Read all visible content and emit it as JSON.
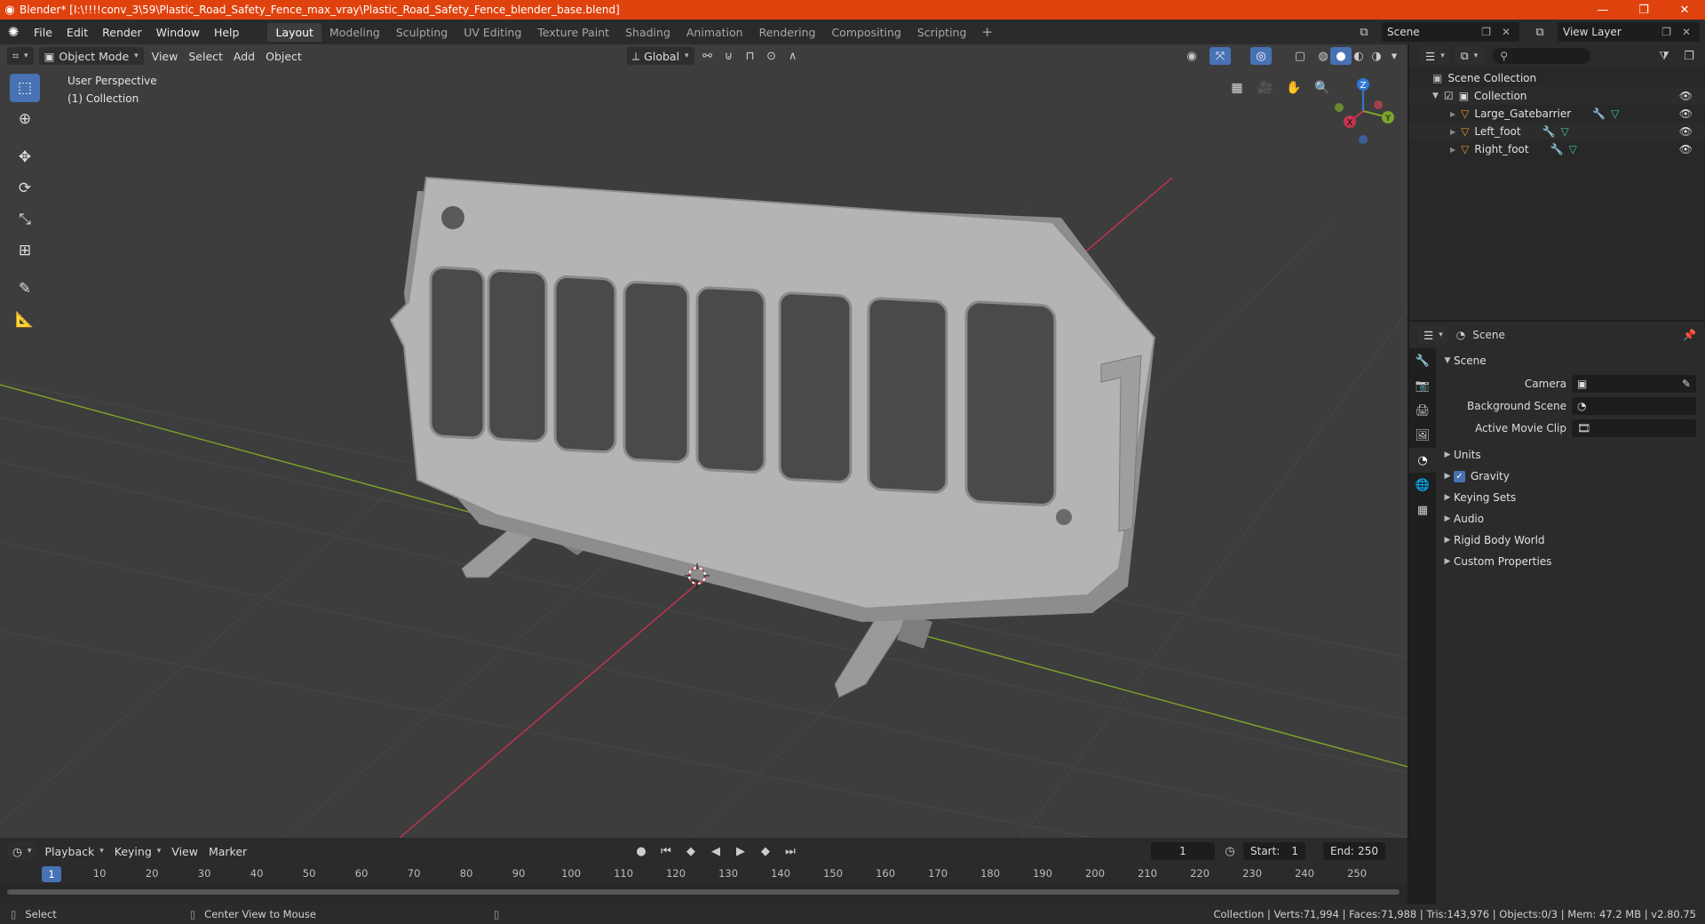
{
  "window": {
    "title": "Blender* [I:\\!!!!conv_3\\59\\Plastic_Road_Safety_Fence_max_vray\\Plastic_Road_Safety_Fence_blender_base.blend]"
  },
  "menu": [
    "File",
    "Edit",
    "Render",
    "Window",
    "Help"
  ],
  "workspaces": [
    "Layout",
    "Modeling",
    "Sculpting",
    "UV Editing",
    "Texture Paint",
    "Shading",
    "Animation",
    "Rendering",
    "Compositing",
    "Scripting"
  ],
  "scene_name": "Scene",
  "view_layer": "View Layer",
  "viewport": {
    "mode": "Object Mode",
    "menus": [
      "View",
      "Select",
      "Add",
      "Object"
    ],
    "transform": "Global",
    "perspective": "User Perspective",
    "collection": "(1) Collection",
    "gizmo": {
      "x": "X",
      "y": "Y",
      "z": "Z"
    }
  },
  "outliner": {
    "root": "Scene Collection",
    "collection": "Collection",
    "objects": [
      "Large_Gatebarrier",
      "Left_foot",
      "Right_foot"
    ]
  },
  "properties": {
    "context": "Scene",
    "panel": "Scene",
    "camera_label": "Camera",
    "background_label": "Background Scene",
    "movieclip_label": "Active Movie Clip",
    "subpanels": [
      "Units",
      "Gravity",
      "Keying Sets",
      "Audio",
      "Rigid Body World",
      "Custom Properties"
    ]
  },
  "timeline": {
    "menus": [
      "Playback",
      "Keying",
      "View",
      "Marker"
    ],
    "current_frame": "1",
    "start_label": "Start:",
    "start": "1",
    "end_label": "End:",
    "end": "250",
    "ticks": [
      "1",
      "10",
      "20",
      "30",
      "40",
      "50",
      "60",
      "70",
      "80",
      "90",
      "100",
      "110",
      "120",
      "130",
      "140",
      "150",
      "160",
      "170",
      "180",
      "190",
      "200",
      "210",
      "220",
      "230",
      "240",
      "250"
    ]
  },
  "status": {
    "left": "Select",
    "middle": "Center View to Mouse",
    "stats": "Collection | Verts:71,994 | Faces:71,988 | Tris:143,976 | Objects:0/3 | Mem: 47.2 MB | v2.80.75"
  },
  "colors": {
    "title_bar": "#e0420e",
    "accent": "#4772b3",
    "axis_x": "#c4344d",
    "axis_y": "#7ea52a",
    "axis_z": "#2f76d6"
  }
}
